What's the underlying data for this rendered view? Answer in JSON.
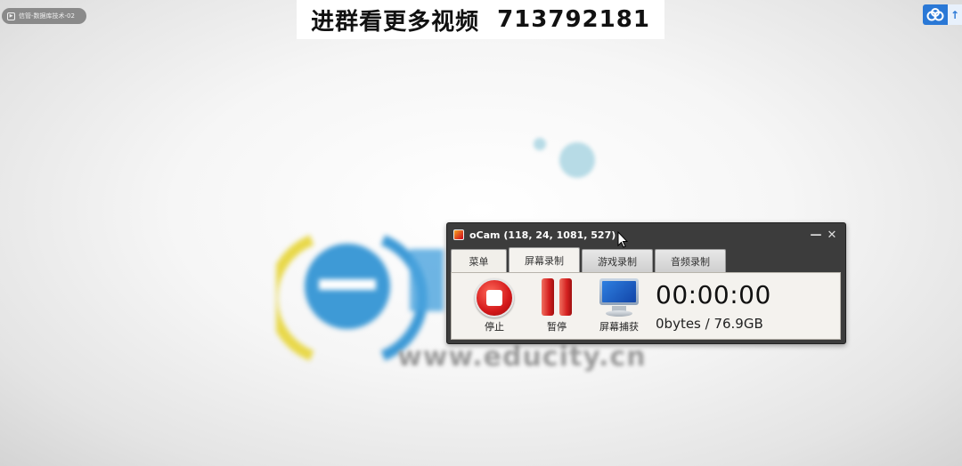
{
  "player_tag": {
    "text": "信管-数据库技术-02"
  },
  "banner": {
    "text": "进群看更多视频",
    "number": "713792181"
  },
  "background": {
    "url_text": "www.educity.cn"
  },
  "ocam": {
    "title": "oCam (118, 24, 1081, 527)",
    "tabs": [
      {
        "label": "菜单"
      },
      {
        "label": "屏幕录制"
      },
      {
        "label": "游戏录制"
      },
      {
        "label": "音频录制"
      }
    ],
    "tools": {
      "stop_label": "停止",
      "pause_label": "暂停",
      "capture_label": "屏幕捕获"
    },
    "timer": "00:00:00",
    "size_info": "0bytes / 76.9GB",
    "minimize_glyph": "—",
    "close_glyph": "✕"
  },
  "colors": {
    "accent_blue": "#2a78d6",
    "stop_red": "#d4181a",
    "window_dark": "#3c3c3c",
    "panel_bg": "#f4f2ee"
  }
}
